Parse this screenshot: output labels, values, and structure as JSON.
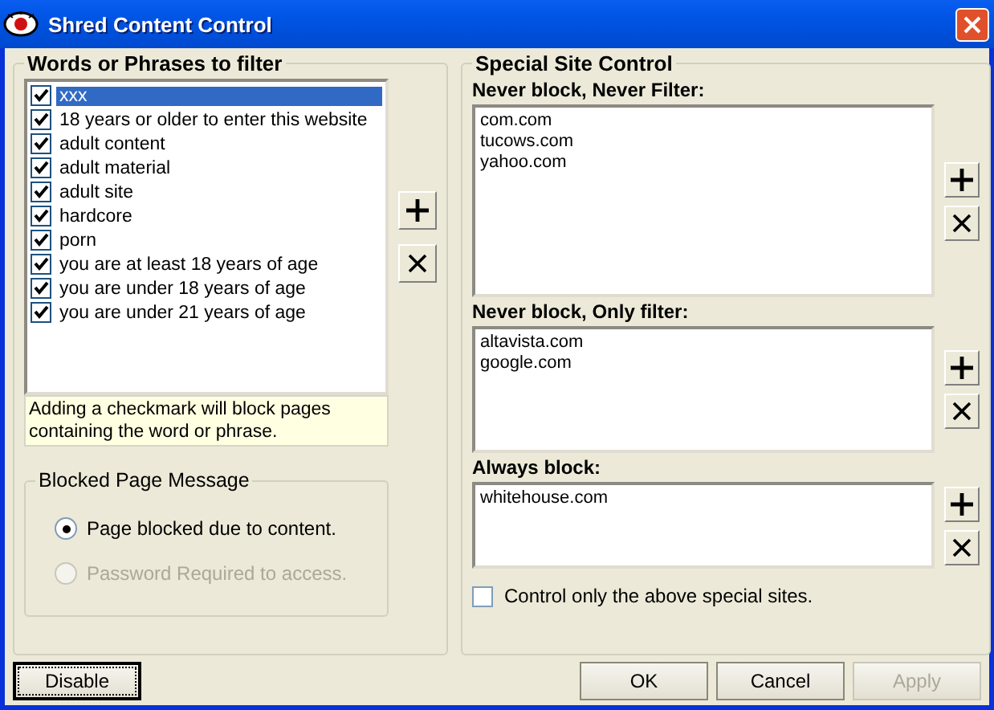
{
  "window": {
    "title": "Shred Content Control"
  },
  "filter_group": {
    "title": "Words or Phrases to filter",
    "items": [
      {
        "label": "xxx",
        "checked": true,
        "selected": true
      },
      {
        "label": "18 years or older to enter this website",
        "checked": true,
        "selected": false
      },
      {
        "label": "adult content",
        "checked": true,
        "selected": false
      },
      {
        "label": "adult material",
        "checked": true,
        "selected": false
      },
      {
        "label": "adult site",
        "checked": true,
        "selected": false
      },
      {
        "label": "hardcore",
        "checked": true,
        "selected": false
      },
      {
        "label": "porn",
        "checked": true,
        "selected": false
      },
      {
        "label": "you are at least 18 years of age",
        "checked": true,
        "selected": false
      },
      {
        "label": "you are under 18 years of age",
        "checked": true,
        "selected": false
      },
      {
        "label": "you are under 21 years of age",
        "checked": true,
        "selected": false
      }
    ],
    "hint": "Adding a checkmark will block pages containing the word or phrase."
  },
  "message_group": {
    "title": "Blocked Page Message",
    "options": [
      {
        "label": "Page blocked due to content.",
        "selected": true,
        "disabled": false
      },
      {
        "label": "Password Required to access.",
        "selected": false,
        "disabled": true
      }
    ]
  },
  "site_group": {
    "title": "Special Site Control",
    "lists": [
      {
        "label": "Never block, Never Filter:",
        "sites": [
          "com.com",
          "tucows.com",
          "yahoo.com"
        ]
      },
      {
        "label": "Never block, Only filter:",
        "sites": [
          "altavista.com",
          "google.com"
        ]
      },
      {
        "label": "Always block:",
        "sites": [
          "whitehouse.com"
        ]
      }
    ],
    "control_only": {
      "label": "Control only the above special sites.",
      "checked": false
    }
  },
  "buttons": [
    {
      "label": "Disable",
      "focused": true,
      "disabled": false
    },
    {
      "label": "OK",
      "focused": false,
      "disabled": false
    },
    {
      "label": "Cancel",
      "focused": false,
      "disabled": false
    },
    {
      "label": "Apply",
      "focused": false,
      "disabled": true
    }
  ]
}
